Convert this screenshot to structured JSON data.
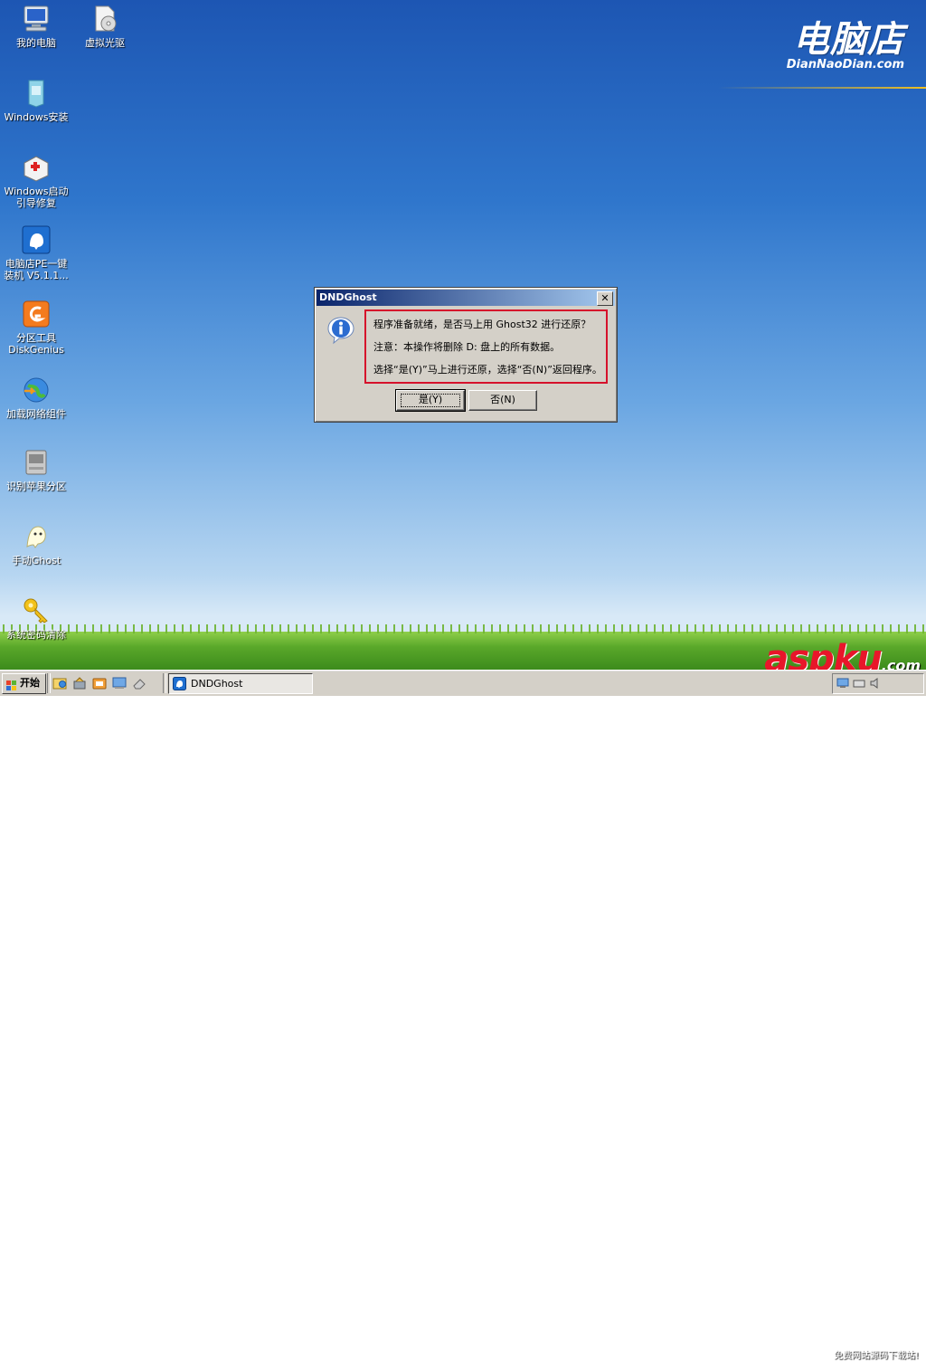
{
  "brand": {
    "logo_cn": "电脑店",
    "logo_en": "DianNaoDian.com"
  },
  "desktop_icons": [
    {
      "name": "我的电脑"
    },
    {
      "name": "虚拟光驱"
    },
    {
      "name": "Windows安装"
    },
    {
      "name": "Windows启动\n引导修复"
    },
    {
      "name": "电脑店PE一键\n装机 V5.1.1..."
    },
    {
      "name": "分区工具\nDiskGenius"
    },
    {
      "name": "加载网络组件"
    },
    {
      "name": "识别苹果分区"
    },
    {
      "name": "手动Ghost"
    },
    {
      "name": "系统密码清除"
    }
  ],
  "dialog": {
    "title": "DNDGhost",
    "close_glyph": "✕",
    "lines": [
      "程序准备就绪，是否马上用 Ghost32 进行还原？",
      "注意：本操作将删除 D: 盘上的所有数据。",
      "选择“是(Y)”马上进行还原，选择“否(N)”返回程序。"
    ],
    "yes_label": "是(Y)",
    "no_label": "否(N)"
  },
  "taskbar": {
    "start_label": "开始",
    "task_item_label": "DNDGhost"
  },
  "watermark": {
    "main": "aspku",
    "suffix": ".com",
    "sub": "免费网站源码下载站!"
  },
  "colors": {
    "highlight_border": "#d6112b",
    "titlebar_start": "#0a246a",
    "titlebar_end": "#a6caf0"
  }
}
